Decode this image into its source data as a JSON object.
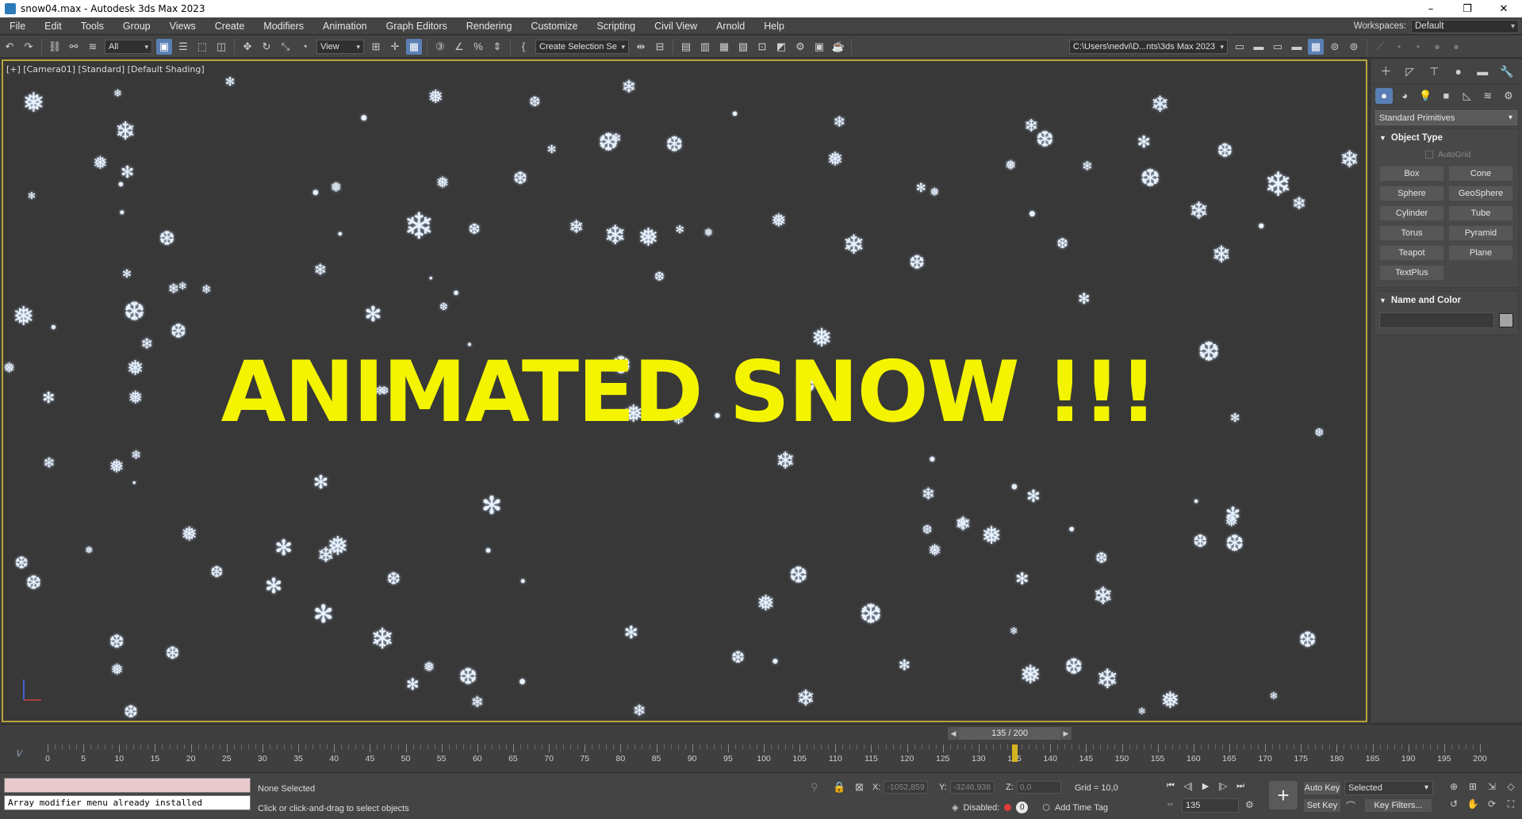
{
  "window": {
    "title": "snow04.max - Autodesk 3ds Max 2023",
    "controls": [
      "–",
      "❐",
      "✕"
    ]
  },
  "menu": {
    "items": [
      "File",
      "Edit",
      "Tools",
      "Group",
      "Views",
      "Create",
      "Modifiers",
      "Animation",
      "Graph Editors",
      "Rendering",
      "Customize",
      "Scripting",
      "Civil View",
      "Arnold",
      "Help"
    ],
    "workspace_label": "Workspaces:",
    "workspace_value": "Default"
  },
  "toolbar": {
    "filter_value": "All",
    "refcoord_value": "View",
    "selection_set": "Create Selection Se",
    "project_path": "C:\\Users\\nedvi\\D...nts\\3ds Max 2023"
  },
  "viewport": {
    "label": "[+] [Camera01] [Standard] [Default Shading]",
    "title_text": "ANIMATED SNOW !!!"
  },
  "command_panel": {
    "dropdown": "Standard Primitives",
    "object_type_title": "Object Type",
    "autogrid_label": "AutoGrid",
    "buttons": [
      "Box",
      "Cone",
      "Sphere",
      "GeoSphere",
      "Cylinder",
      "Tube",
      "Torus",
      "Pyramid",
      "Teapot",
      "Plane",
      "TextPlus"
    ],
    "name_color_title": "Name and Color",
    "swatch_color": "#a3a3a3"
  },
  "timeline": {
    "frame_display": "135 / 200",
    "current_frame": 135,
    "total_frames": 200,
    "ruler_labels": [
      "0",
      "5",
      "10",
      "15",
      "20",
      "25",
      "30",
      "35",
      "40",
      "45",
      "50",
      "55",
      "60",
      "65",
      "70",
      "75",
      "80",
      "85",
      "90",
      "95",
      "100",
      "105",
      "110",
      "115",
      "120",
      "125",
      "130",
      "135",
      "140",
      "145",
      "150",
      "155",
      "160",
      "165",
      "170",
      "175",
      "180",
      "185",
      "190",
      "195",
      "200"
    ]
  },
  "status": {
    "maxscript_output": "Array modifier menu already installed",
    "selection_info": "None Selected",
    "prompt": "Click or click-and-drag to select objects",
    "x_label": "X:",
    "x_value": "-1052,859",
    "y_label": "Y:",
    "y_value": "-3246,938",
    "z_label": "Z:",
    "z_value": "0,0",
    "grid": "Grid = 10,0",
    "disabled_label": "Disabled:",
    "disabled_count": "0",
    "add_time_tag": "Add Time Tag",
    "frame_field": "135",
    "auto_key": "Auto Key",
    "set_key": "Set Key",
    "selected_dropdown": "Selected",
    "key_filters": "Key Filters..."
  },
  "colors": {
    "viewport_bg": "#383838",
    "title_yellow": "#f4f400",
    "active_border": "#b9a43a",
    "accent_blue": "#5a7fb5"
  }
}
